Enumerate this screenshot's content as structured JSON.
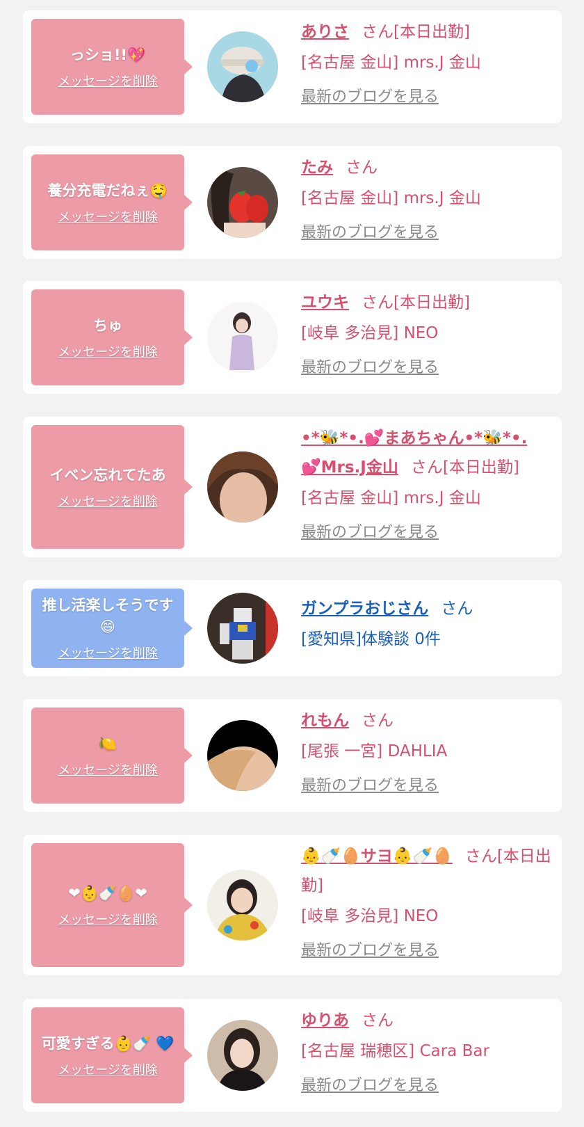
{
  "delete_label": "メッセージを削除",
  "blog_label": "最新のブログを見る",
  "san_label": "さん",
  "cards": [
    {
      "message": "っショ!!💖",
      "name": "ありさ",
      "suffix": "さん[本日出勤]",
      "shop": "[名古屋 金山] mrs.J 金山",
      "blog": "最新のブログを見る",
      "bubble_color": "#ee9ba8"
    },
    {
      "message": "養分充電だねぇ🤤",
      "name": "たみ",
      "suffix": "さん",
      "shop": "[名古屋 金山] mrs.J 金山",
      "blog": "最新のブログを見る",
      "bubble_color": "#ee9ba8"
    },
    {
      "message": "ちゅ",
      "name": "ユウキ",
      "suffix": "さん[本日出勤]",
      "shop": "[岐阜 多治見] NEO",
      "blog": "最新のブログを見る",
      "bubble_color": "#ee9ba8"
    },
    {
      "message": "イベン忘れてたあ",
      "name": "•*🐝*•.💕まあちゃん•*🐝*•. 💕Mrs.J金山",
      "suffix": "さん[本日出勤]",
      "shop": "[名古屋 金山] mrs.J 金山",
      "blog": "最新のブログを見る",
      "bubble_color": "#ee9ba8"
    },
    {
      "message": "推し活楽しそうです 😄",
      "name": "ガンプラおじさん",
      "suffix": "さん",
      "shop": "[愛知県]体験談 0件",
      "blog": "",
      "bubble_color": "#8fb3f1"
    },
    {
      "message": "🍋",
      "name": "れもん",
      "suffix": "さん",
      "shop": "[尾張 一宮] DAHLIA",
      "blog": "最新のブログを見る",
      "bubble_color": "#ee9ba8"
    },
    {
      "message": "❤👶🍼🥚❤",
      "name": "👶🍼🥚サヨ👶🍼🥚",
      "suffix": "さん[本日出勤]",
      "shop": "[岐阜 多治見] NEO",
      "blog": "最新のブログを見る",
      "bubble_color": "#ee9ba8"
    },
    {
      "message": "可愛すぎる👶🍼 💙",
      "name": "ゆりあ",
      "suffix": "さん",
      "shop": "[名古屋 瑞穂区] Cara Bar",
      "blog": "最新のブログを見る",
      "bubble_color": "#ee9ba8"
    }
  ],
  "colors": {
    "accent_pink": "#d6506e",
    "bubble_pink": "#ee9ba8",
    "bubble_blue": "#8fb3f1",
    "user_blue": "#1b5fb8"
  }
}
